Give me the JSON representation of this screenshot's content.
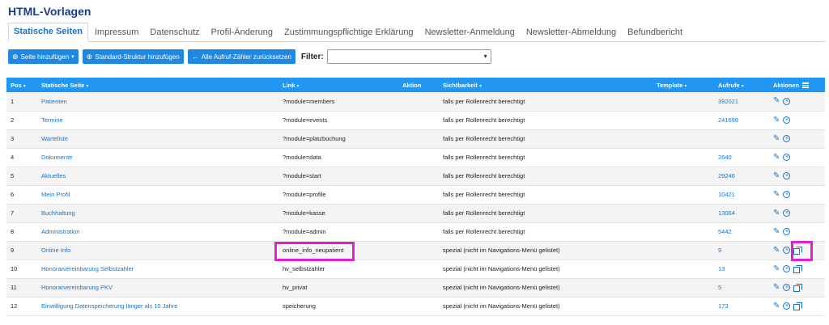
{
  "page_title": "HTML-Vorlagen",
  "tabs": [
    {
      "label": "Statische Seiten",
      "active": true
    },
    {
      "label": "Impressum",
      "active": false
    },
    {
      "label": "Datenschutz",
      "active": false
    },
    {
      "label": "Profil-Änderung",
      "active": false
    },
    {
      "label": "Zustimmungspflichtige Erklärung",
      "active": false
    },
    {
      "label": "Newsletter-Anmeldung",
      "active": false
    },
    {
      "label": "Newsletter-Abmeldung",
      "active": false
    },
    {
      "label": "Befundbericht",
      "active": false
    }
  ],
  "toolbar": {
    "add_page_label": "Seite hinzufügen",
    "add_structure_label": "Standard-Struktur hinzufügen",
    "reset_counters_label": "Alle Aufruf-Zähler zurücksetzen",
    "filter_label": "Filter:",
    "filter_value": ""
  },
  "table": {
    "headers": {
      "pos": "Pos",
      "page": "Statische Seite",
      "link": "Link",
      "action": "Aktion",
      "visibility": "Sichtbarkeit",
      "template": "Template",
      "calls": "Aufrufe",
      "actions": "Aktionen"
    },
    "rows": [
      {
        "pos": "1",
        "page": "Patienten",
        "link": "?module=members",
        "visibility": "falls per Rollenrecht berechtigt",
        "template": "",
        "calls": "392021",
        "copy": false
      },
      {
        "pos": "2",
        "page": "Termine",
        "link": "?module=events",
        "visibility": "falls per Rollenrecht berechtigt",
        "template": "",
        "calls": "241698",
        "copy": false
      },
      {
        "pos": "3",
        "page": "Warteliste",
        "link": "?module=platzbuchung",
        "visibility": "falls per Rollenrecht berechtigt",
        "template": "",
        "calls": "",
        "copy": false
      },
      {
        "pos": "4",
        "page": "Dokumente",
        "link": "?module=data",
        "visibility": "falls per Rollenrecht berechtigt",
        "template": "",
        "calls": "2640",
        "copy": false
      },
      {
        "pos": "5",
        "page": "Aktuelles",
        "link": "?module=start",
        "visibility": "falls per Rollenrecht berechtigt",
        "template": "",
        "calls": "29246",
        "copy": false
      },
      {
        "pos": "6",
        "page": "Mein Profil",
        "link": "?module=profile",
        "visibility": "falls per Rollenrecht berechtigt",
        "template": "",
        "calls": "10421",
        "copy": false
      },
      {
        "pos": "7",
        "page": "Buchhaltung",
        "link": "?module=kasse",
        "visibility": "falls per Rollenrecht berechtigt",
        "template": "",
        "calls": "13064",
        "copy": false
      },
      {
        "pos": "8",
        "page": "Administration",
        "link": "?module=admin",
        "visibility": "falls per Rollenrecht berechtigt",
        "template": "",
        "calls": "5442",
        "copy": false
      },
      {
        "pos": "9",
        "page": "Online Info",
        "link": "online_info_neupatient",
        "visibility": "spezial (nicht im Navigations-Menü gelistet)",
        "template": "",
        "calls": "9",
        "copy": true
      },
      {
        "pos": "10",
        "page": "Honorarvereinbarung Selbstzahler",
        "link": "hv_selbstzahler",
        "visibility": "spezial (nicht im Navigations-Menü gelistet)",
        "template": "",
        "calls": "13",
        "copy": true
      },
      {
        "pos": "11",
        "page": "Honorarvereinbarung PKV",
        "link": "hv_privat",
        "visibility": "spezial (nicht im Navigations-Menü gelistet)",
        "template": "",
        "calls": "5",
        "copy": true
      },
      {
        "pos": "12",
        "page": "Einwilligung Datenspeicherung länger als 10 Jahre",
        "link": "speicherung",
        "visibility": "spezial (nicht im Navigations-Menü gelistet)",
        "template": "",
        "calls": "173",
        "copy": true
      }
    ]
  },
  "colors": {
    "accent": "#2196f3",
    "link": "#1a73c8",
    "highlight": "#e020d0"
  }
}
